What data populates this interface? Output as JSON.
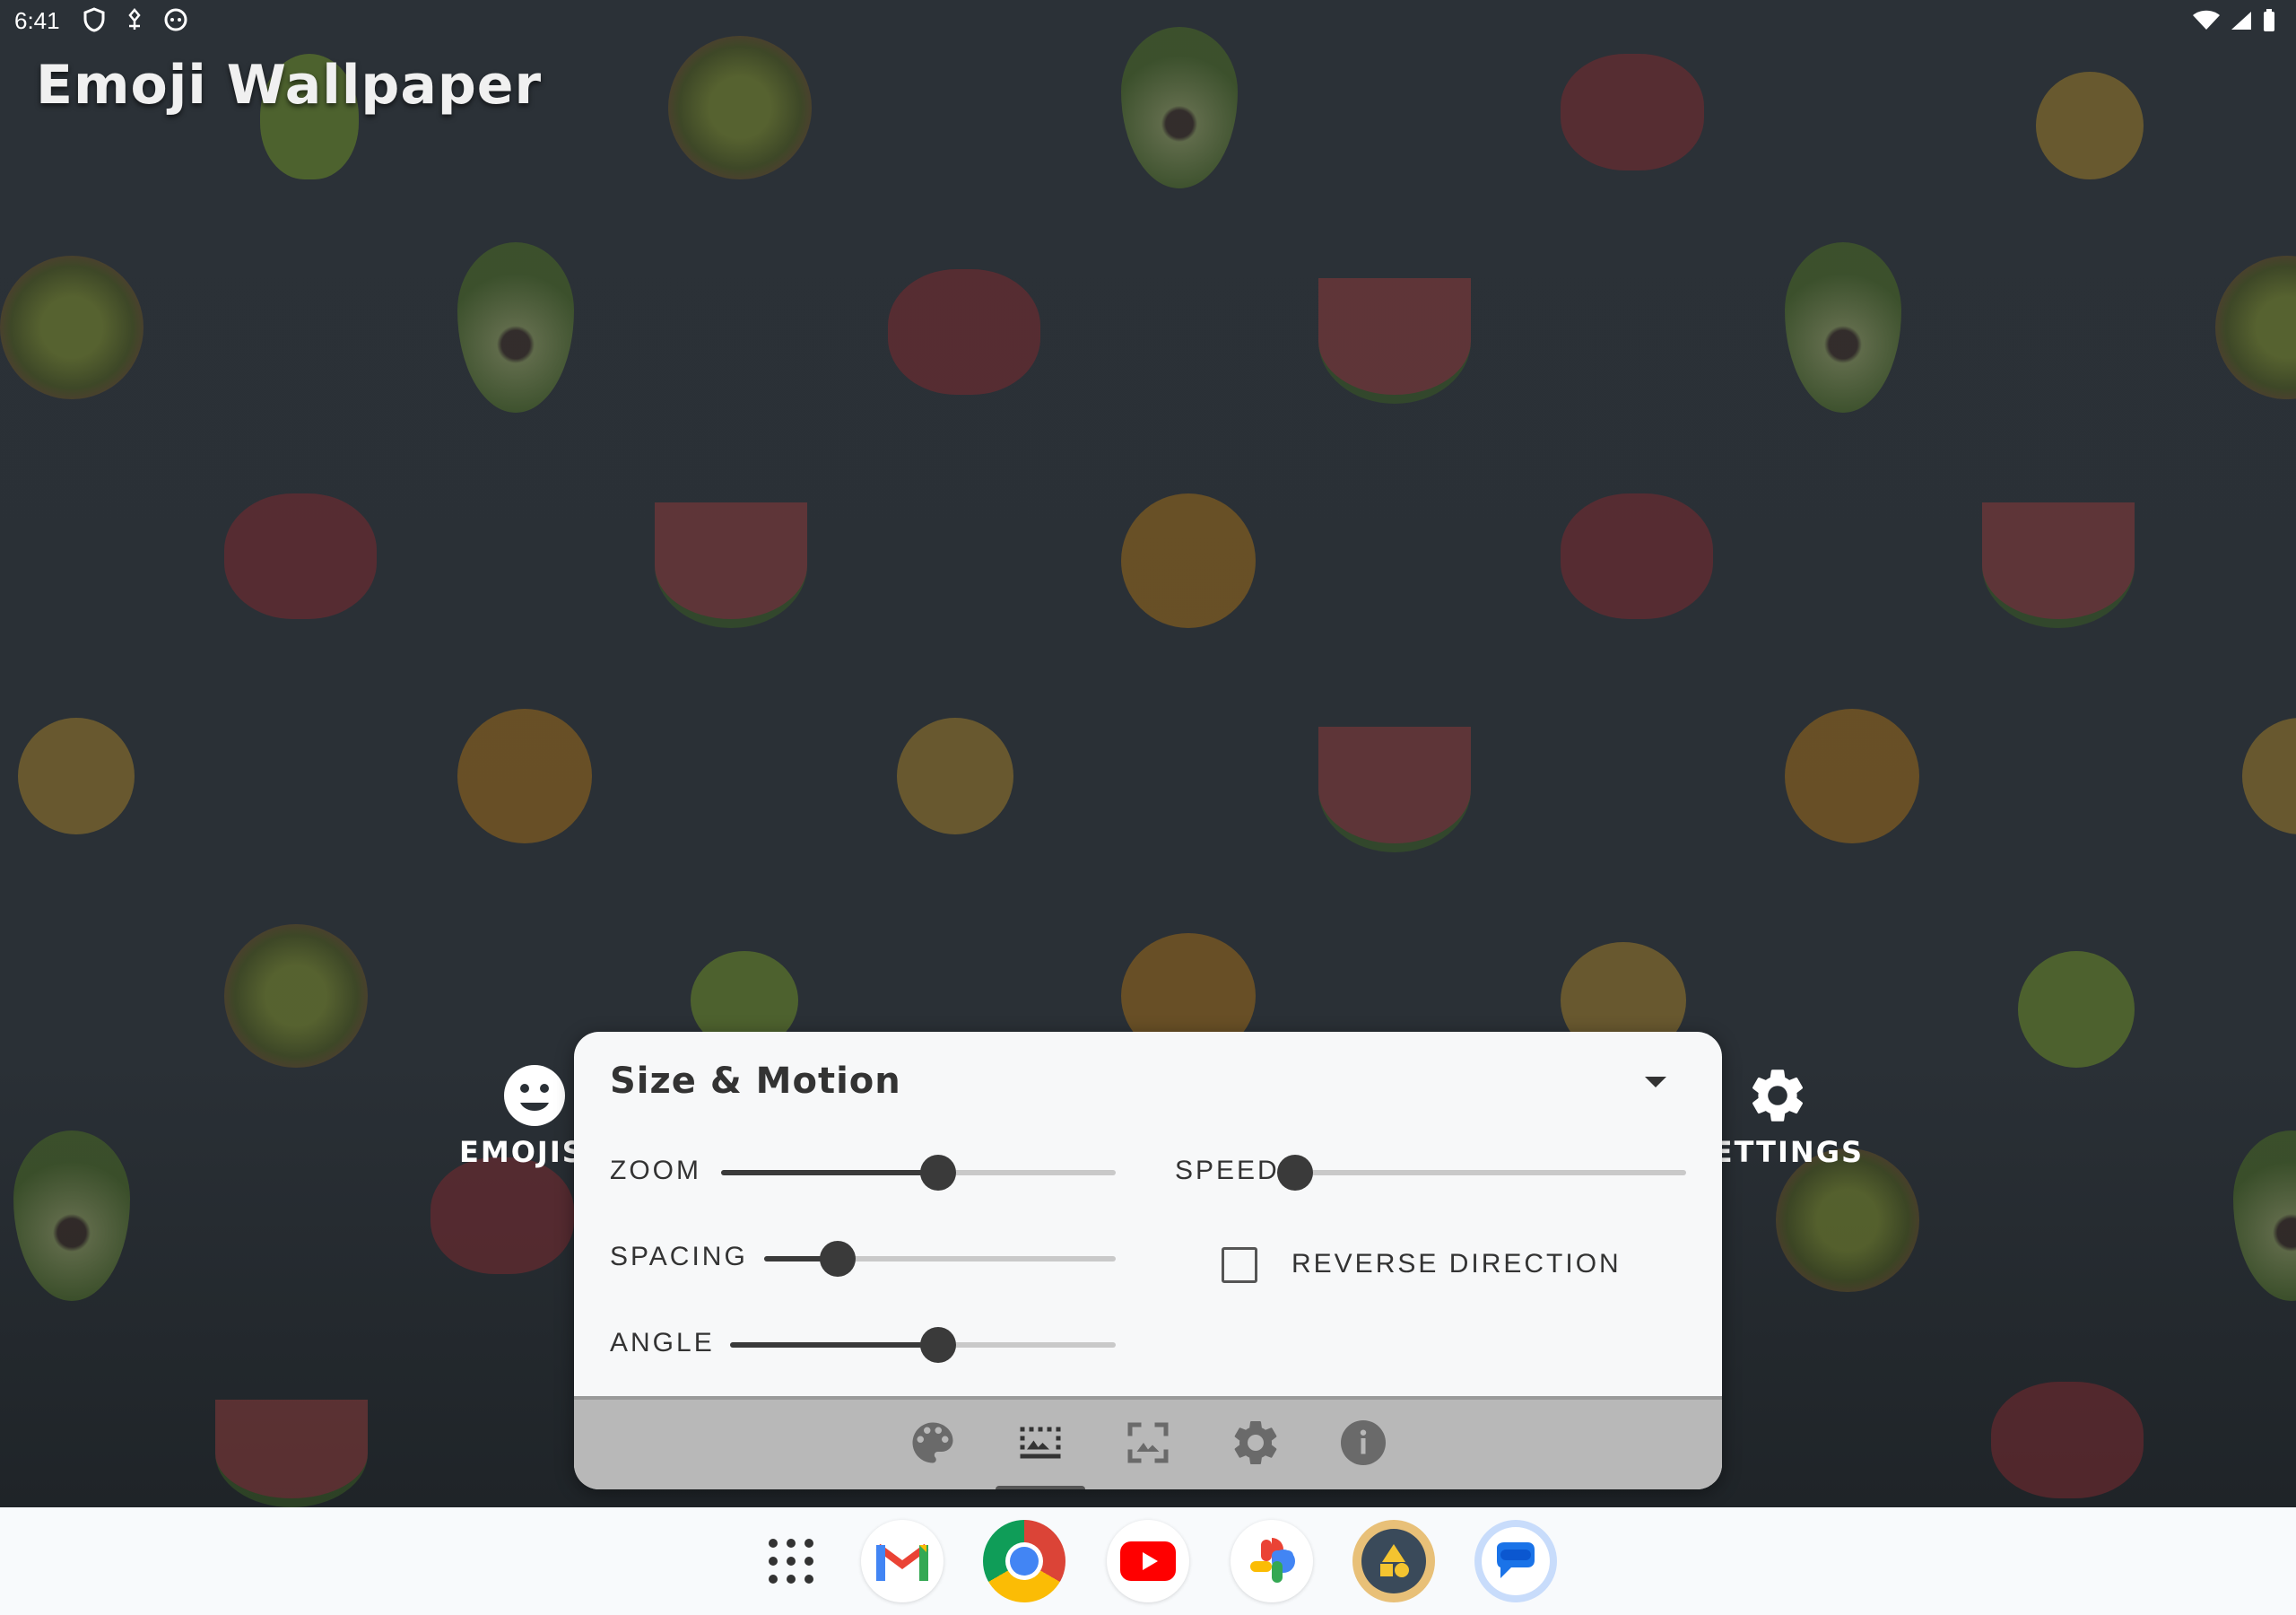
{
  "status_bar": {
    "time": "6:41"
  },
  "app": {
    "title": "Emoji Wallpaper"
  },
  "side_tabs": {
    "left_label": "EMOJIS",
    "right_label": "SETTINGS"
  },
  "panel": {
    "title": "Size & Motion",
    "sliders": [
      {
        "label": "ZOOM",
        "value": 0.55
      },
      {
        "label": "SPACING",
        "value": 0.21
      },
      {
        "label": "ANGLE",
        "value": 0.54
      },
      {
        "label": "SPEED",
        "value": 0.0
      }
    ],
    "reverse_direction": {
      "label": "REVERSE DIRECTION",
      "checked": false
    },
    "footer_icons": [
      "palette-icon",
      "wallpaper-region-icon",
      "image-icon",
      "gear-icon",
      "info-icon"
    ],
    "selected_footer_index": 1
  },
  "dock": {
    "apps": [
      "app-drawer-icon",
      "gmail-icon",
      "chrome-icon",
      "youtube-icon",
      "photos-icon",
      "shapes-app-icon",
      "messages-icon"
    ]
  },
  "colors": {
    "accent_dark": "#3a3a3a",
    "panel_bg": "#f7f8f9",
    "footer_bg": "#b8b8b8"
  }
}
